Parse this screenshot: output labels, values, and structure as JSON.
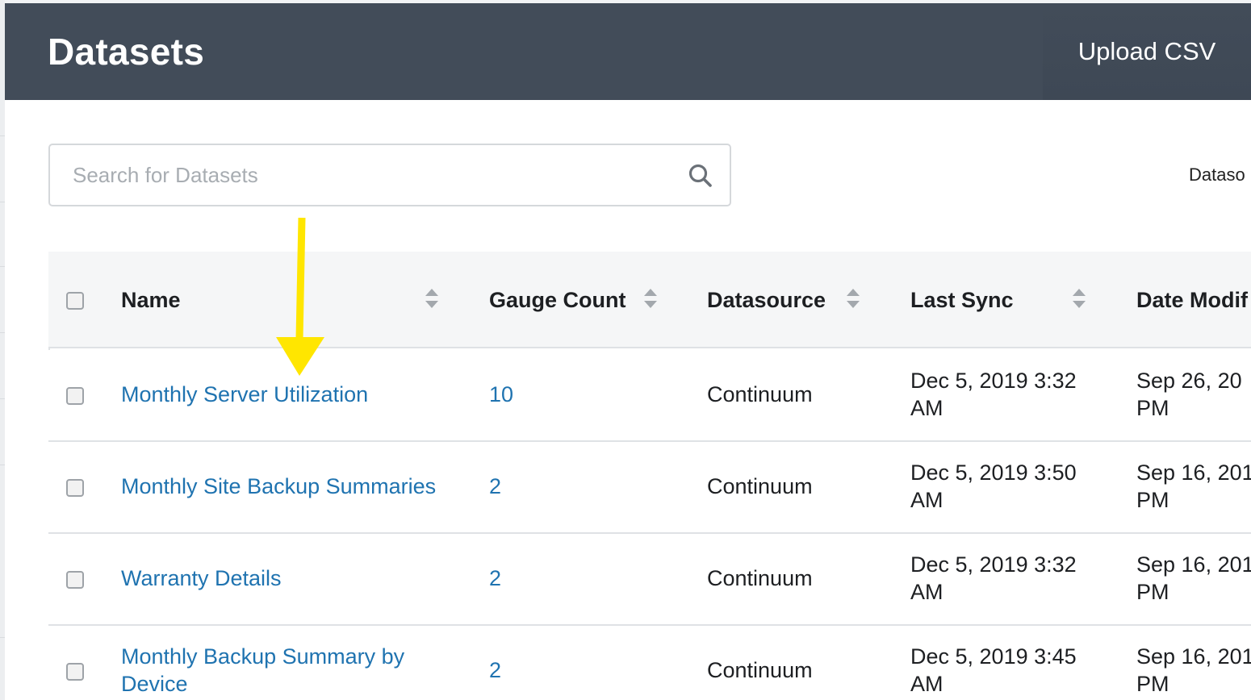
{
  "header": {
    "title": "Datasets",
    "upload_label": "Upload CSV"
  },
  "search": {
    "placeholder": "Search for Datasets",
    "value": ""
  },
  "filter": {
    "label": "Dataso"
  },
  "table": {
    "columns": {
      "name": "Name",
      "gauge_count": "Gauge Count",
      "datasource": "Datasource",
      "last_sync": "Last Sync",
      "date_modified": "Date Modif"
    },
    "rows": [
      {
        "name": "Monthly Server Utilization",
        "gauge_count": "10",
        "datasource": "Continuum",
        "last_sync_line1": "Dec 5, 2019 3:32",
        "last_sync_line2": "AM",
        "modified_line1": "Sep 26, 20",
        "modified_line2": "PM"
      },
      {
        "name": "Monthly Site Backup Summaries",
        "gauge_count": "2",
        "datasource": "Continuum",
        "last_sync_line1": "Dec 5, 2019 3:50",
        "last_sync_line2": "AM",
        "modified_line1": "Sep 16, 201",
        "modified_line2": "PM"
      },
      {
        "name": "Warranty Details",
        "gauge_count": "2",
        "datasource": "Continuum",
        "last_sync_line1": "Dec 5, 2019 3:32",
        "last_sync_line2": "AM",
        "modified_line1": "Sep 16, 201",
        "modified_line2": "PM"
      },
      {
        "name_line1": "Monthly Backup Summary by",
        "name_line2": "Device",
        "gauge_count": "2",
        "datasource": "Continuum",
        "last_sync_line1": "Dec 5, 2019 3:45",
        "last_sync_line2": "AM",
        "modified_line1": "Sep 16, 201",
        "modified_line2": "PM"
      }
    ]
  },
  "colors": {
    "header_bg": "#424c59",
    "link": "#1f73b0",
    "annotation_arrow": "#ffe600"
  },
  "icons": {
    "search": "search-icon",
    "sort": "sort-icon",
    "annotation": "arrow-down-icon"
  }
}
